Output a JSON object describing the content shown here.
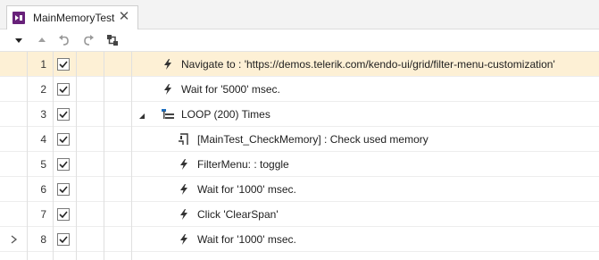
{
  "tab": {
    "title": "MainMemoryTest",
    "icon": "test-file-icon",
    "close_glyph": "✕"
  },
  "toolbar": {
    "buttons": [
      {
        "name": "dropdown-arrow-icon"
      },
      {
        "name": "move-up-icon"
      },
      {
        "name": "undo-icon"
      },
      {
        "name": "redo-icon"
      },
      {
        "name": "pin-step-icon"
      }
    ]
  },
  "steps": [
    {
      "num": "1",
      "checked": true,
      "icon": "lightning-icon",
      "text": "Navigate to : 'https://demos.telerik.com/kendo-ui/grid/filter-menu-customization'",
      "indent": 0,
      "selected": true
    },
    {
      "num": "2",
      "checked": true,
      "icon": "lightning-icon",
      "text": "Wait for '5000' msec.",
      "indent": 0
    },
    {
      "num": "3",
      "checked": true,
      "icon": "loop-icon",
      "text": "LOOP (200) Times",
      "indent": 0,
      "expanded": true
    },
    {
      "num": "4",
      "checked": true,
      "icon": "test-as-step-icon",
      "text": "[MainTest_CheckMemory] : Check used memory",
      "indent": 1
    },
    {
      "num": "5",
      "checked": true,
      "icon": "lightning-icon",
      "text": "FilterMenu: : toggle",
      "indent": 1
    },
    {
      "num": "6",
      "checked": true,
      "icon": "lightning-icon",
      "text": "Wait for '1000' msec.",
      "indent": 1
    },
    {
      "num": "7",
      "checked": true,
      "icon": "lightning-icon",
      "text": "Click 'ClearSpan'",
      "indent": 1
    },
    {
      "num": "8",
      "checked": true,
      "icon": "lightning-icon",
      "text": "Wait for '1000' msec.",
      "indent": 1,
      "current": true
    }
  ],
  "colors": {
    "selected_row": "#fdf0d5",
    "tab_icon": "#68217a"
  }
}
